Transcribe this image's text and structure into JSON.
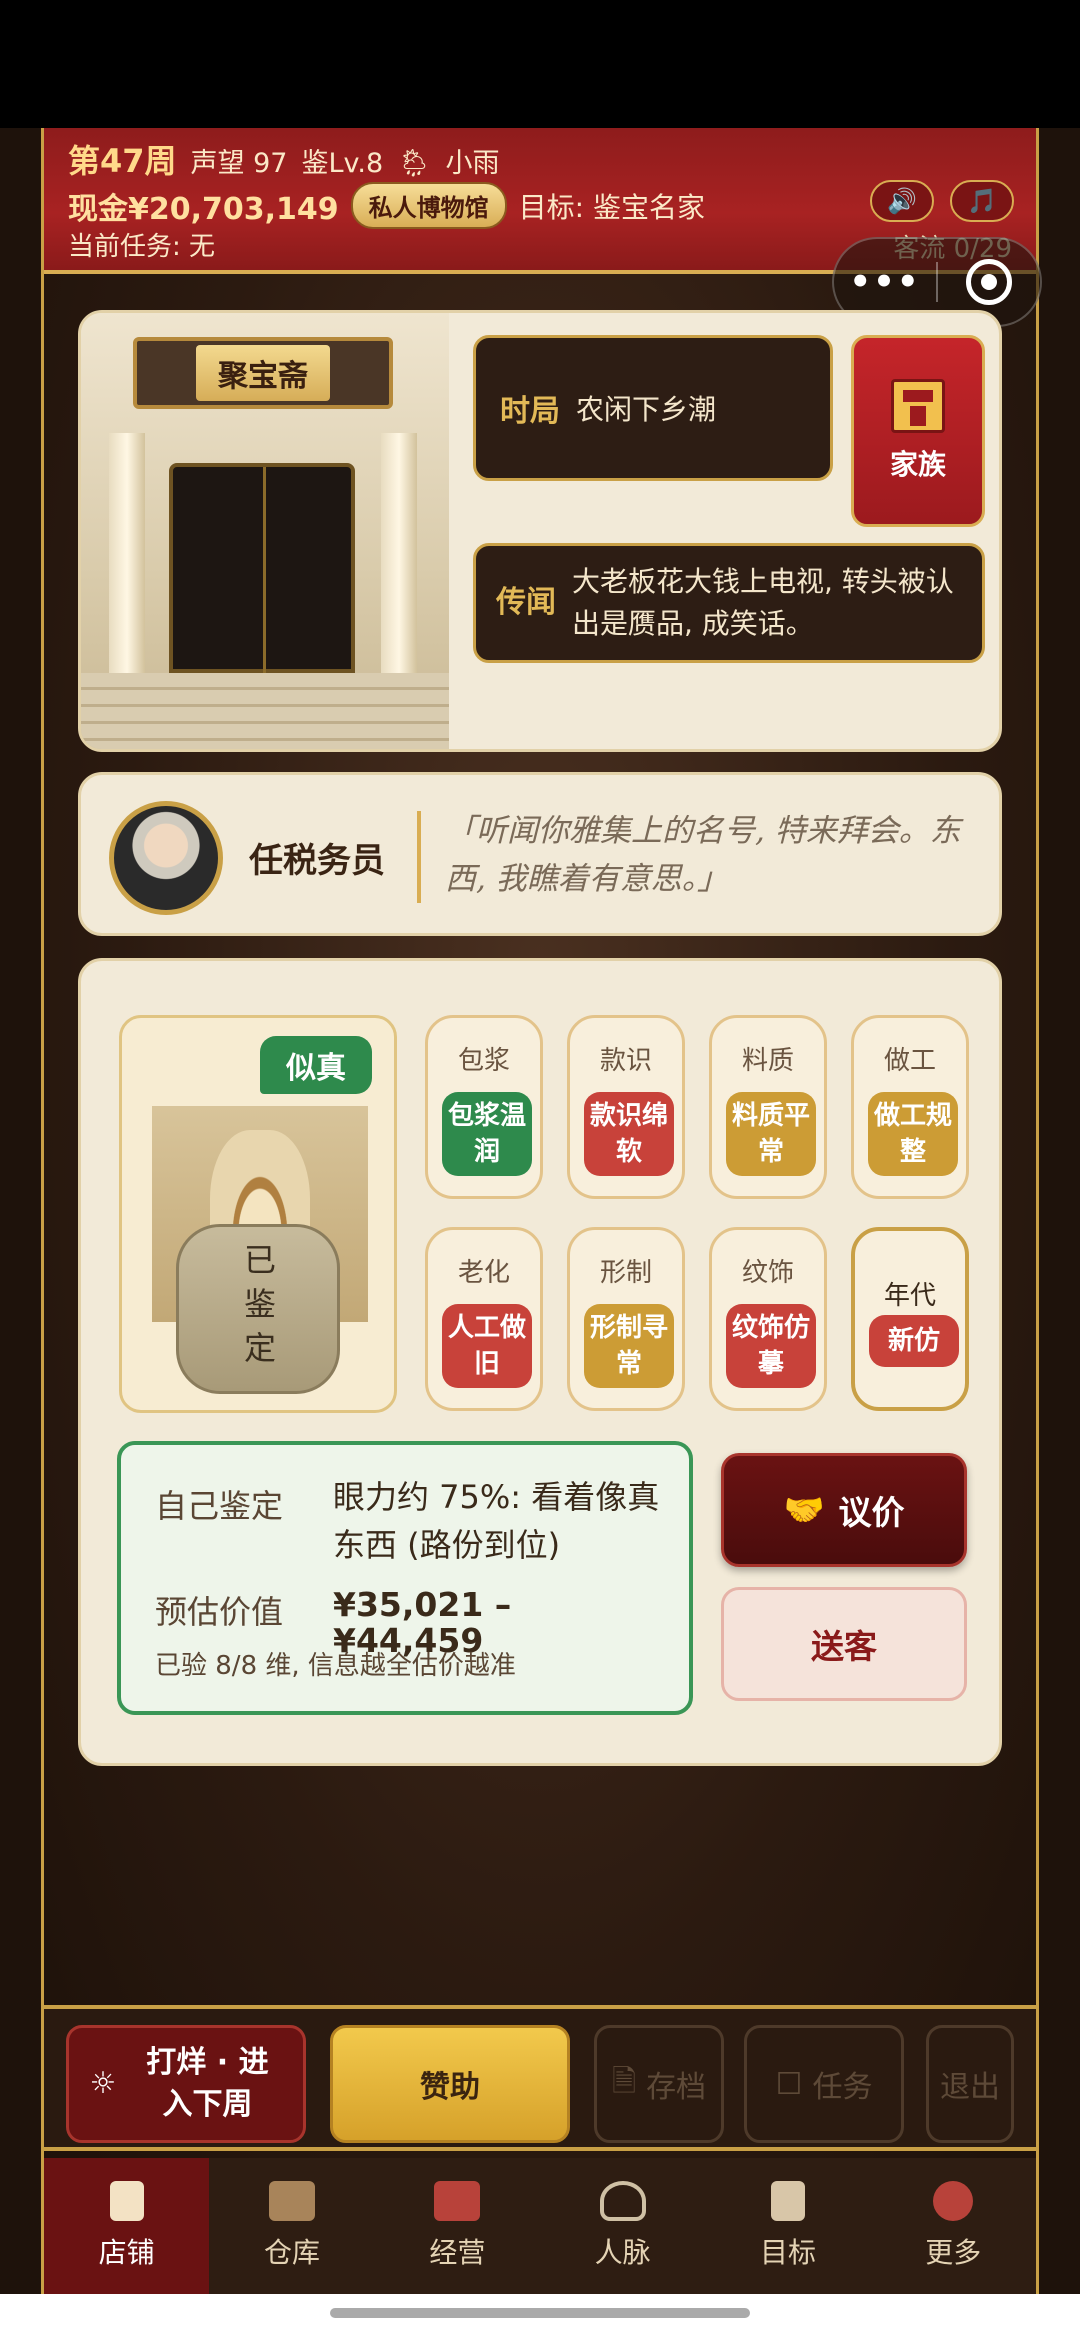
{
  "header": {
    "week": "第47周",
    "reputation": "声望 97",
    "level": "鉴Lv.8",
    "weather": "小雨",
    "cash": "现金¥20,703,149",
    "museum": "私人博物馆",
    "goal": "目标: 鉴宝名家",
    "task": "当前任务: 无",
    "traffic": "客流 0/29",
    "sound_icon": "🔊",
    "music_icon": "🎵"
  },
  "capsule": {
    "more": "•••"
  },
  "shop": {
    "sign": "聚宝斋",
    "era_label": "时局",
    "era_value": "农闲下乡潮",
    "rumor_label": "传闻",
    "rumor_value": "大老板花大钱上电视, 转头被认出是赝品, 成笑话。",
    "family": "家族"
  },
  "customer": {
    "name": "任税务员",
    "quote": "「听闻你雅集上的名号, 特来拜会。东西, 我瞧着有意思。」"
  },
  "item": {
    "verdict": "似真",
    "stamp": "已鉴定"
  },
  "attributes": [
    {
      "title": "包浆",
      "value": "包浆温润",
      "color": "green"
    },
    {
      "title": "款识",
      "value": "款识绵软",
      "color": "red"
    },
    {
      "title": "料质",
      "value": "料质平常",
      "color": "gold"
    },
    {
      "title": "做工",
      "value": "做工规整",
      "color": "gold"
    },
    {
      "title": "老化",
      "value": "人工做旧",
      "color": "red"
    },
    {
      "title": "形制",
      "value": "形制寻常",
      "color": "gold"
    },
    {
      "title": "纹饰",
      "value": "纹饰仿摹",
      "color": "red"
    },
    {
      "title": "年代",
      "value": "新仿",
      "color": "red"
    }
  ],
  "result": {
    "self_label": "自己鉴定",
    "self_value": "眼力约 75%: 看着像真东西 (路份到位)",
    "estimate_label": "预估价值",
    "estimate_value": "¥35,021 – ¥44,459",
    "note": "已验 8/8 维, 信息越全估价越准"
  },
  "buttons": {
    "bargain": "议价",
    "send_off": "送客"
  },
  "actions": {
    "next_week": "打烊 · 进入下周",
    "sponsor": "赞助",
    "save": "存档",
    "tasks": "任务",
    "exit": "退出"
  },
  "nav": [
    {
      "label": "店铺",
      "icon": "shop-icon"
    },
    {
      "label": "仓库",
      "icon": "warehouse-icon"
    },
    {
      "label": "经营",
      "icon": "business-icon"
    },
    {
      "label": "人脉",
      "icon": "contacts-icon"
    },
    {
      "label": "目标",
      "icon": "goal-icon"
    },
    {
      "label": "更多",
      "icon": "more-icon"
    }
  ],
  "colors": {
    "header_red": "#a82222",
    "gold": "#c9a046",
    "green": "#2e8a4c",
    "red": "#c8423a",
    "amber": "#cc9c35"
  }
}
